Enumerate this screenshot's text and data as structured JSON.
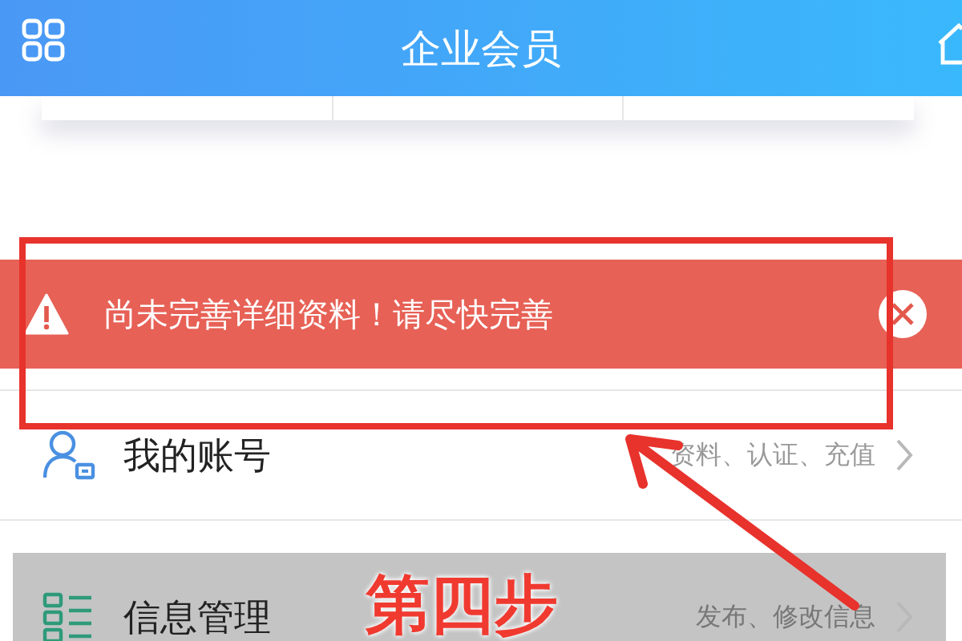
{
  "header": {
    "title": "企业会员"
  },
  "alert": {
    "message": "尚未完善详细资料！请尽快完善"
  },
  "menu": [
    {
      "kind": "account",
      "label": "我的账号",
      "hint": "资料、认证、充值",
      "selected": false
    },
    {
      "kind": "info",
      "label": "信息管理",
      "hint": "发布、修改信息",
      "selected": true
    }
  ],
  "annotation": {
    "step_label": "第四步"
  }
}
